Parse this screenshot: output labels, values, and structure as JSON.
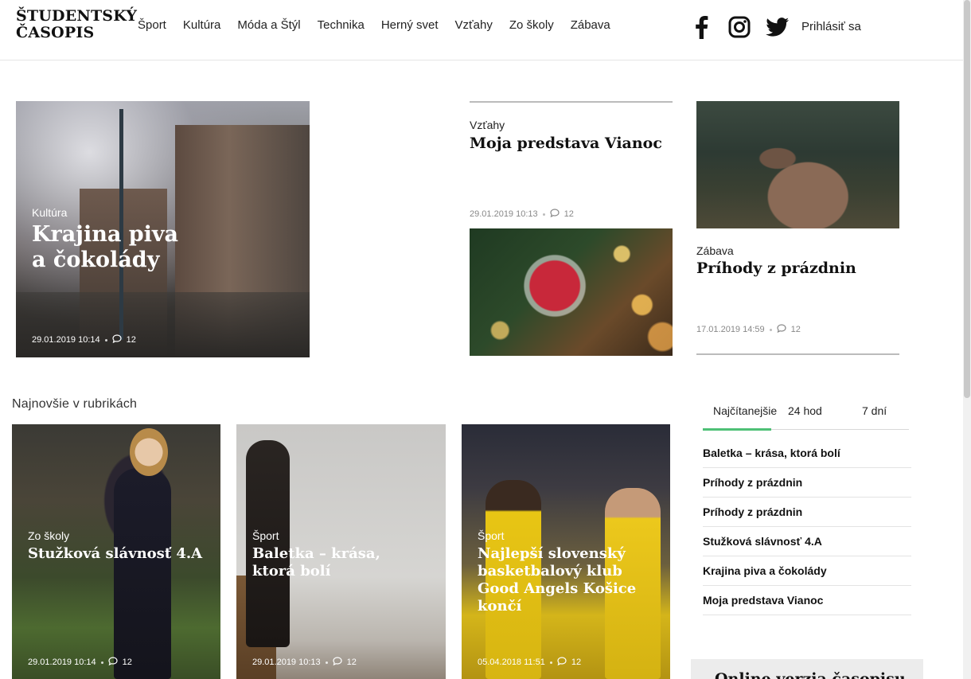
{
  "brand": {
    "line1": "ŠTUDENTSKÝ",
    "line2": "ČASOPIS"
  },
  "nav": [
    {
      "label": "Šport"
    },
    {
      "label": "Kultúra"
    },
    {
      "label": "Móda a Štýl"
    },
    {
      "label": "Technika"
    },
    {
      "label": "Herný svet"
    },
    {
      "label": "Vzťahy"
    },
    {
      "label": "Zo školy"
    },
    {
      "label": "Zábava"
    }
  ],
  "social": [
    "facebook-icon",
    "instagram-icon",
    "twitter-icon"
  ],
  "login_label": "Prihlásiť sa",
  "hero": {
    "category": "Kultúra",
    "title_line1": "Krajina piva",
    "title_line2": "a čokolády",
    "date": "29.01.2019 10:14",
    "comments": "12"
  },
  "vztahy": {
    "category": "Vzťahy",
    "title": "Moja predstava Vianoc",
    "date": "29.01.2019 10:13",
    "comments": "12"
  },
  "zabava": {
    "category": "Zábava",
    "title": "Príhody z prázdnin",
    "date": "17.01.2019 14:59",
    "comments": "12"
  },
  "section_title": "Najnovšie v rubrikách",
  "cards": [
    {
      "category": "Zo školy",
      "title_line1": "Stužková slávnosť 4.A",
      "title_line2": "",
      "title_line3": "",
      "title_line4": "",
      "date": "29.01.2019 10:14",
      "comments": "12"
    },
    {
      "category": "Šport",
      "title_line1": "Baletka – krása,",
      "title_line2": "ktorá bolí",
      "title_line3": "",
      "title_line4": "",
      "date": "29.01.2019 10:13",
      "comments": "12"
    },
    {
      "category": "Šport",
      "title_line1": "Najlepší slovenský",
      "title_line2": "basketbalový klub",
      "title_line3": "Good Angels Košice",
      "title_line4": "končí",
      "date": "05.04.2018 11:51",
      "comments": "12"
    }
  ],
  "tabs": [
    {
      "label": "Najčítanejšie"
    },
    {
      "label": "24 hod"
    },
    {
      "label": "7 dní"
    }
  ],
  "accent_color": "#4ec076",
  "ranking": [
    {
      "title": "Baletka – krása, ktorá bolí"
    },
    {
      "title": "Príhody z prázdnin"
    },
    {
      "title": "Príhody z prázdnin"
    },
    {
      "title": "Stužková slávnosť 4.A"
    },
    {
      "title": "Krajina piva a čokolády"
    },
    {
      "title": "Moja predstava Vianoc"
    }
  ],
  "online_title": "Online verzia časopisu"
}
